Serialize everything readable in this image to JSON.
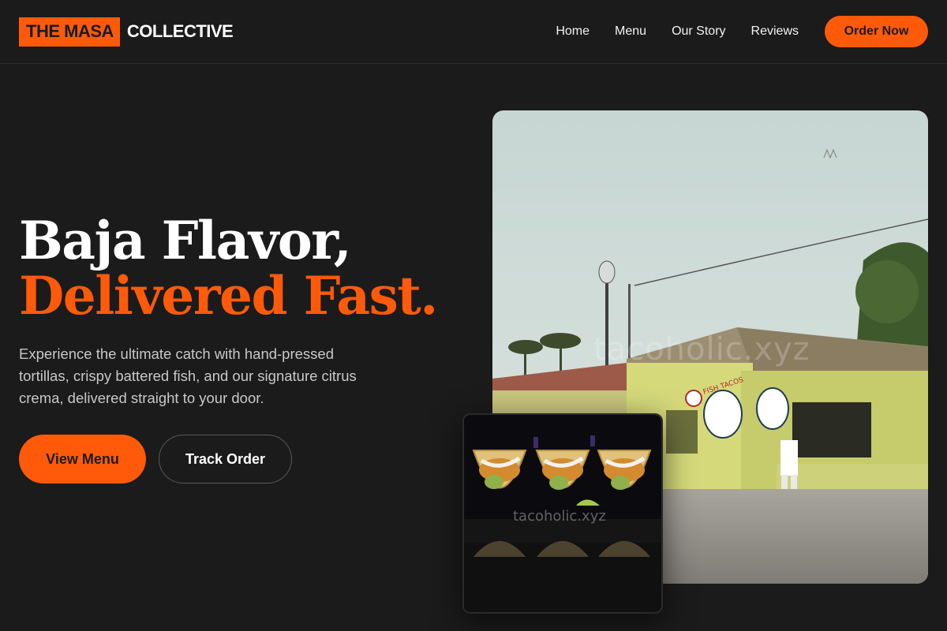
{
  "brand": {
    "highlight": "THE MASA",
    "rest": "COLLECTIVE",
    "accent_color": "#ff5a0a",
    "background": "#1b1b1b"
  },
  "nav": {
    "links": [
      "Home",
      "Menu",
      "Our Story",
      "Reviews"
    ],
    "cta": "Order Now"
  },
  "hero": {
    "title_line1": "Baja Flavor,",
    "title_line2": "Delivered Fast.",
    "description": "Experience the ultimate catch with hand-pressed tortillas, crispy battered fish, and our signature citrus crema, delivered straight to your door.",
    "primary_button": "View Menu",
    "secondary_button": "Track Order"
  },
  "images": {
    "main": {
      "watermark": "tacoholic.xyz",
      "sign_text": "FISH TACOS"
    },
    "thumbnail": {
      "watermark": "tacoholic.xyz"
    }
  }
}
